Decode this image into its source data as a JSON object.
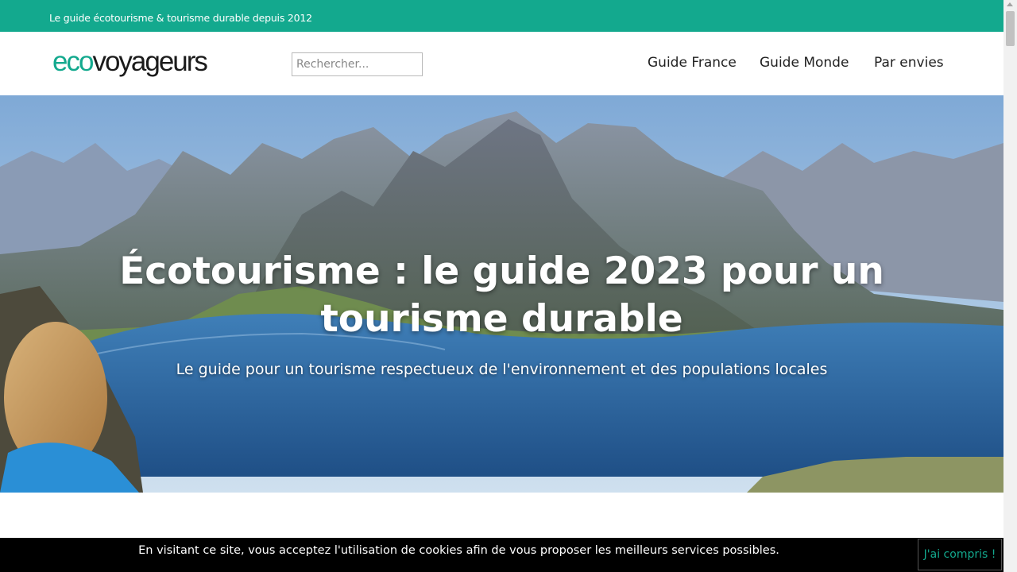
{
  "topbar": {
    "tagline": "Le guide écotourisme & tourisme durable depuis 2012"
  },
  "logo": {
    "part1": "eco",
    "part2": "voyageurs"
  },
  "search": {
    "placeholder": "Rechercher..."
  },
  "nav": {
    "items": [
      {
        "label": "Guide France"
      },
      {
        "label": "Guide Monde"
      },
      {
        "label": "Par envies"
      }
    ]
  },
  "hero": {
    "title": "Écotourisme : le guide 2023 pour un tourisme durable",
    "subtitle": "Le guide pour un tourisme respectueux de l'environnement et des populations locales"
  },
  "cookie": {
    "text": "En visitant ce site, vous acceptez l'utilisation de cookies afin de vous proposer les meilleurs services possibles.",
    "button": "J'ai compris !"
  },
  "colors": {
    "brand": "#13a98e",
    "cookie_bg": "#000000"
  },
  "icons": {
    "scroll_up": "chevron-up-icon"
  }
}
